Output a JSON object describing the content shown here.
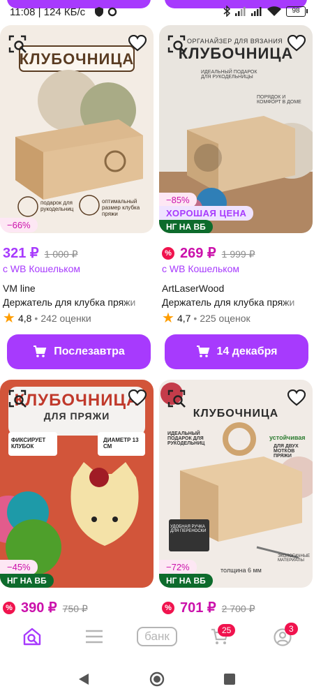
{
  "status_bar": {
    "time": "11:08",
    "speed": "124 КБ/с",
    "battery": "98"
  },
  "products": [
    {
      "image_title": "КЛУБОЧНИЦА",
      "image_notes": [
        "подарок для рукодельниц",
        "оптимальный размер клубка пряжи"
      ],
      "discount": "−66%",
      "price": "321 ₽",
      "old_price": "1 000 ₽",
      "wallet": "с WB Кошельком",
      "brand": "VM line",
      "name": "Держатель для клубка пряжи",
      "rating": "4,8",
      "reviews": "242 оценки",
      "buy_label": "Послезавтра"
    },
    {
      "image_subtitle": "ОРГАНАЙЗЕР ДЛЯ ВЯЗАНИЯ",
      "image_title": "КЛУБОЧНИЦА",
      "image_notes": [
        "ИДЕАЛЬНЫЙ ПОДАРОК ДЛЯ РУКОДЕЛЬНИЦЫ",
        "ПОРЯДОК И КОМФОРТ В ДОМЕ"
      ],
      "discount": "−85%",
      "good_price": "ХОРОШАЯ ЦЕНА",
      "ng_badge": "НГ НА ВБ",
      "price": "269 ₽",
      "old_price": "1 999 ₽",
      "wallet": "с WB Кошельком",
      "brand": "ArtLaserWood",
      "name": "Держатель для клубка пряжи",
      "rating": "4,7",
      "reviews": "225 оценок",
      "buy_label": "14 декабря"
    },
    {
      "image_title": "КЛУБОЧНИЦА",
      "image_subtitle": "ДЛЯ ПРЯЖИ",
      "image_notes": [
        "ФИКСИРУЕТ КЛУБОК",
        "ДИАМЕТР 13 СМ"
      ],
      "discount": "−45%",
      "ng_badge": "НГ НА ВБ",
      "price": "390 ₽",
      "old_price": "750 ₽"
    },
    {
      "image_title": "КЛУБОЧНИЦА",
      "image_notes": [
        "ИДЕАЛЬНЫЙ ПОДАРОК ДЛЯ РУКОДЕЛЬНИЦ",
        "устойчивая",
        "ДЛЯ ДВУХ МОТКОВ ПРЯЖИ",
        "УДОБНАЯ РУЧКА ДЛЯ ПЕРЕНОСКИ",
        "ЭКОЛОГИЧНЫЕ МАТЕРИАЛЫ",
        "толщина 6 мм"
      ],
      "discount": "−72%",
      "ng_badge": "НГ НА ВБ",
      "price": "701 ₽",
      "old_price": "2 700 ₽"
    }
  ],
  "nav": {
    "bank_label": "банк",
    "cart_count": "25",
    "profile_count": "3"
  },
  "colors": {
    "accent": "#a73afd",
    "price_red": "#cb11ab",
    "ng_green": "#0d6b2c",
    "star": "#ff9d00"
  }
}
